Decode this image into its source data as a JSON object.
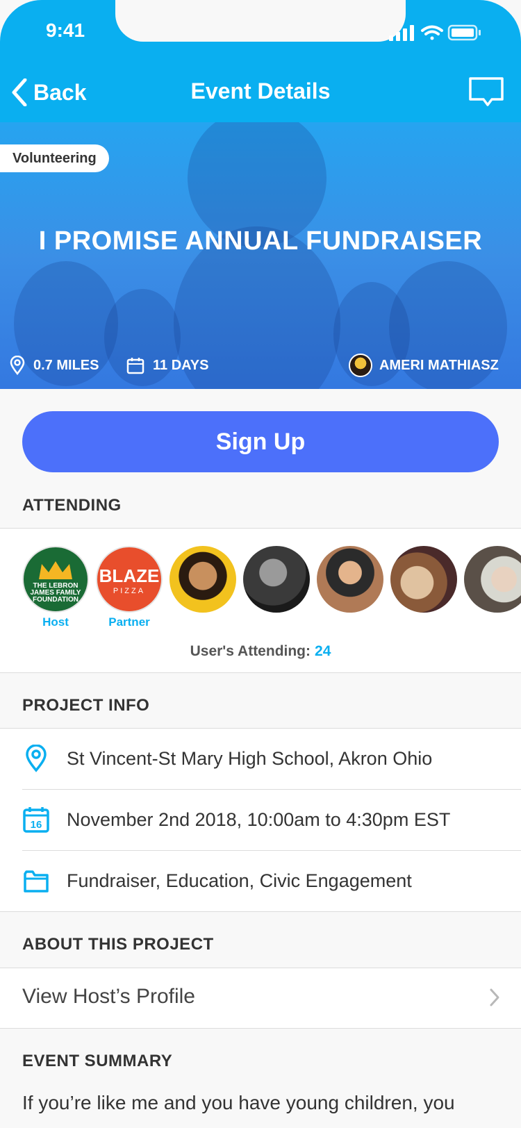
{
  "status": {
    "time": "9:41"
  },
  "nav": {
    "back_label": "Back",
    "title": "Event Details"
  },
  "event": {
    "category": "Volunteering",
    "title": "I PROMISE ANNUAL FUNDRAISER",
    "distance": "0.7 MILES",
    "days": "11 DAYS",
    "host_name": "AMERI MATHIASZ"
  },
  "signup_label": "Sign Up",
  "attending": {
    "label": "ATTENDING",
    "host_logo_lines": [
      "THE LEBRON",
      "JAMES FAMILY",
      "FOUNDATION"
    ],
    "partner_logo_top": "BLAZE",
    "partner_logo_bottom": "PIZZA",
    "host_label": "Host",
    "partner_label": "Partner",
    "count_label": "User's Attending:",
    "count": "24"
  },
  "project_info": {
    "label": "PROJECT INFO",
    "location": "St Vincent-St Mary High School, Akron Ohio",
    "datetime": "November 2nd 2018, 10:00am to 4:30pm EST",
    "calendar_day": "16",
    "tags": "Fundraiser, Education, Civic Engagement"
  },
  "about": {
    "label": "ABOUT THIS PROJECT",
    "profile_link": "View Host’s Profile"
  },
  "summary": {
    "label": "EVENT SUMMARY",
    "text": "If you’re like me and you have young children, you"
  },
  "colors": {
    "primary": "#0aaff0",
    "button": "#4c70fa",
    "hero": "#3b8fe6"
  }
}
